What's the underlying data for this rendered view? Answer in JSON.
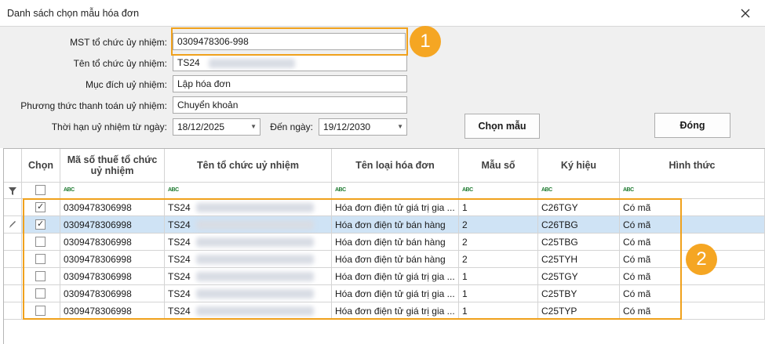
{
  "window": {
    "title": "Danh sách chọn mẫu hóa đơn"
  },
  "form": {
    "mst_label": "MST tổ chức ủy nhiệm:",
    "mst_value": "0309478306-998",
    "name_label": "Tên tổ chức ủy nhiệm:",
    "name_value": "TS24",
    "purpose_label": "Mục đích uỷ nhiệm:",
    "purpose_value": "Lập hóa đơn",
    "payment_label": "Phương thức thanh toán uỷ nhiệm:",
    "payment_value": "Chuyển khoản",
    "from_label": "Thời hạn uỷ nhiệm từ ngày:",
    "from_value": "18/12/2025",
    "to_label": "Đến ngày:",
    "to_value": "19/12/2030"
  },
  "buttons": {
    "choose": "Chọn mẫu",
    "close": "Đóng"
  },
  "callouts": {
    "one": "1",
    "two": "2"
  },
  "grid": {
    "headers": {
      "chon": "Chọn",
      "mst": "Mã số thuế tổ chức uỷ nhiệm",
      "ten": "Tên tổ chức uỷ nhiệm",
      "loai": "Tên loại hóa đơn",
      "mau": "Mẫu số",
      "kyhieu": "Ký hiệu",
      "hinhthuc": "Hình thức"
    },
    "filter_token": "ABC",
    "rows": [
      {
        "checked": true,
        "mst": "0309478306998",
        "ten": "TS24",
        "loai": "Hóa đơn điện tử giá trị gia ...",
        "mau": "1",
        "kyhieu": "C26TGY",
        "hinhthuc": "Có mã"
      },
      {
        "checked": true,
        "mst": "0309478306998",
        "ten": "TS24",
        "loai": "Hóa đơn điện tử bán hàng",
        "mau": "2",
        "kyhieu": "C26TBG",
        "hinhthuc": "Có mã"
      },
      {
        "checked": false,
        "mst": "0309478306998",
        "ten": "TS24",
        "loai": "Hóa đơn điện tử bán hàng",
        "mau": "2",
        "kyhieu": "C25TBG",
        "hinhthuc": "Có mã"
      },
      {
        "checked": false,
        "mst": "0309478306998",
        "ten": "TS24",
        "loai": "Hóa đơn điện tử bán hàng",
        "mau": "2",
        "kyhieu": "C25TYH",
        "hinhthuc": "Có mã"
      },
      {
        "checked": false,
        "mst": "0309478306998",
        "ten": "TS24",
        "loai": "Hóa đơn điện tử giá trị gia ...",
        "mau": "1",
        "kyhieu": "C25TGY",
        "hinhthuc": "Có mã"
      },
      {
        "checked": false,
        "mst": "0309478306998",
        "ten": "TS24",
        "loai": "Hóa đơn điện tử giá trị gia ...",
        "mau": "1",
        "kyhieu": "C25TBY",
        "hinhthuc": "Có mã"
      },
      {
        "checked": false,
        "mst": "0309478306998",
        "ten": "TS24",
        "loai": "Hóa đơn điện tử giá trị gia ...",
        "mau": "1",
        "kyhieu": "C25TYP",
        "hinhthuc": "Có mã"
      }
    ]
  },
  "colors": {
    "accent": "#f5a623",
    "selected_row": "#cfe3f5"
  },
  "icons": {
    "close": "close-icon",
    "filter": "filter-icon",
    "edit": "pencil-icon",
    "dropdown": "chevron-down-icon"
  }
}
